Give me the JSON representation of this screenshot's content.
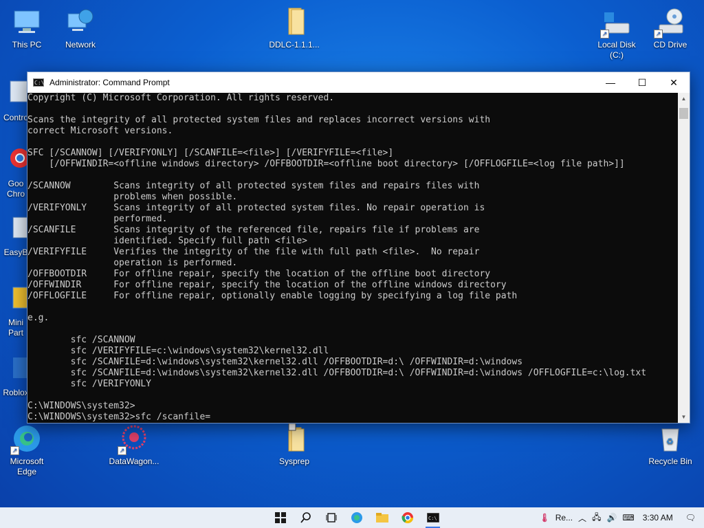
{
  "desktop": {
    "icons": [
      {
        "label": "This PC"
      },
      {
        "label": "Network"
      },
      {
        "label": "DDLC-1.1.1..."
      },
      {
        "label": "Local Disk (C:)"
      },
      {
        "label": "CD Drive"
      },
      {
        "label": "Contro"
      },
      {
        "label": "Goo\nChro"
      },
      {
        "label": "EasyB"
      },
      {
        "label": "Mini\nPart"
      },
      {
        "label": "Roblox"
      },
      {
        "label": "Microsoft\nEdge"
      },
      {
        "label": "DataWagon..."
      },
      {
        "label": "Sysprep"
      },
      {
        "label": "Recycle Bin"
      }
    ]
  },
  "window": {
    "title": "Administrator: Command Prompt",
    "icon": "cmd-icon",
    "console_lines": [
      "Copyright (C) Microsoft Corporation. All rights reserved.",
      "",
      "Scans the integrity of all protected system files and replaces incorrect versions with",
      "correct Microsoft versions.",
      "",
      "SFC [/SCANNOW] [/VERIFYONLY] [/SCANFILE=<file>] [/VERIFYFILE=<file>]",
      "    [/OFFWINDIR=<offline windows directory> /OFFBOOTDIR=<offline boot directory> [/OFFLOGFILE=<log file path>]]",
      "",
      "/SCANNOW        Scans integrity of all protected system files and repairs files with",
      "                problems when possible.",
      "/VERIFYONLY     Scans integrity of all protected system files. No repair operation is",
      "                performed.",
      "/SCANFILE       Scans integrity of the referenced file, repairs file if problems are",
      "                identified. Specify full path <file>",
      "/VERIFYFILE     Verifies the integrity of the file with full path <file>.  No repair",
      "                operation is performed.",
      "/OFFBOOTDIR     For offline repair, specify the location of the offline boot directory",
      "/OFFWINDIR      For offline repair, specify the location of the offline windows directory",
      "/OFFLOGFILE     For offline repair, optionally enable logging by specifying a log file path",
      "",
      "e.g.",
      "",
      "        sfc /SCANNOW",
      "        sfc /VERIFYFILE=c:\\windows\\system32\\kernel32.dll",
      "        sfc /SCANFILE=d:\\windows\\system32\\kernel32.dll /OFFBOOTDIR=d:\\ /OFFWINDIR=d:\\windows",
      "        sfc /SCANFILE=d:\\windows\\system32\\kernel32.dll /OFFBOOTDIR=d:\\ /OFFWINDIR=d:\\windows /OFFLOGFILE=c:\\log.txt",
      "        sfc /VERIFYONLY",
      "",
      "C:\\WINDOWS\\system32>",
      "C:\\WINDOWS\\system32>sfc /scanfile="
    ]
  },
  "taskbar": {
    "apps": [
      "start-icon",
      "search-icon",
      "task-view-icon",
      "edge-icon",
      "file-explorer-icon",
      "chrome-icon",
      "cmd-icon"
    ],
    "tray": {
      "notification_label": "Re...",
      "time": "3:30 AM"
    }
  }
}
